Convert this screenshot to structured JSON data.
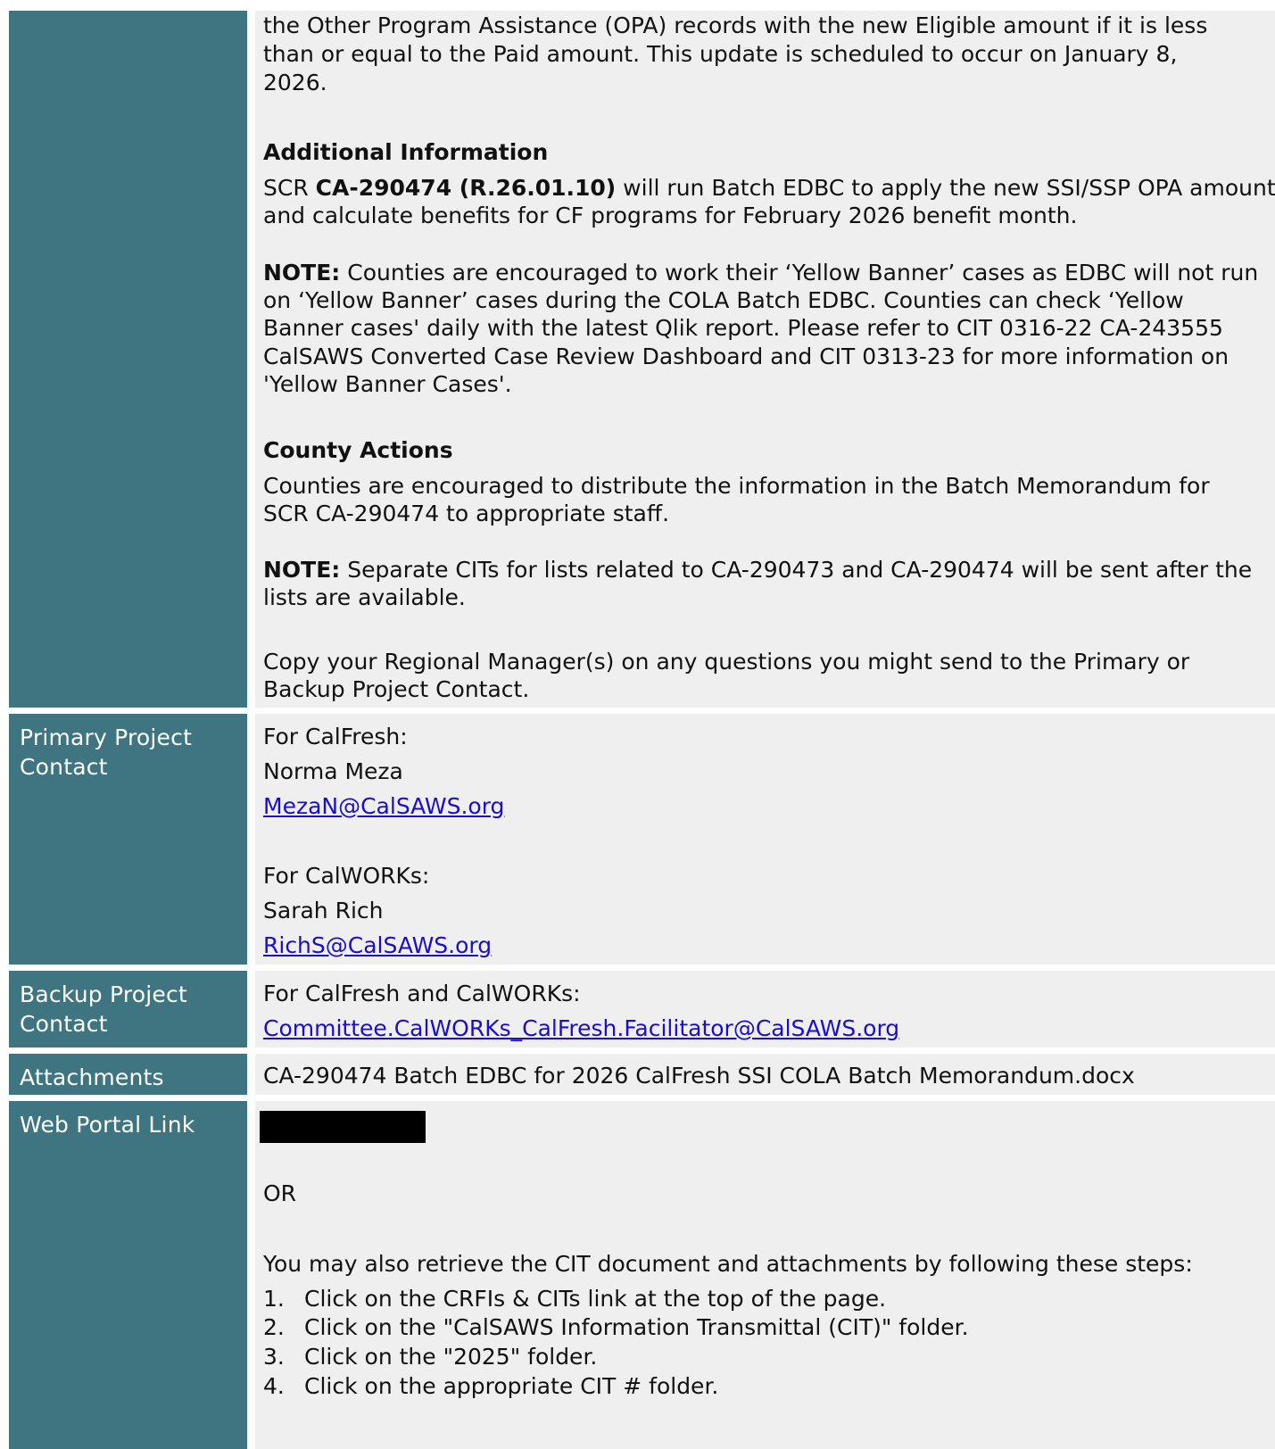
{
  "intro": {
    "lines": [
      "the Other Program Assistance (OPA) records with the new Eligible amount if it is less",
      "than or equal to the Paid amount. This update is scheduled to occur on January 8,",
      "2026."
    ]
  },
  "additional_information": {
    "heading": "Additional Information",
    "scr_prefix": "SCR ",
    "scr_bold": "CA-290474 (R.26.01.10)",
    "scr_line1_rest": " will run Batch EDBC to apply the new SSI/SSP OPA amounts",
    "scr_line2": "and calculate benefits for CF programs for February 2026 benefit month.",
    "note_label": "NOTE:",
    "note_line1_rest": " Counties are encouraged to work their ‘Yellow Banner’ cases as EDBC will not run",
    "note_lines": [
      "on ‘Yellow Banner’ cases during the COLA Batch EDBC.  Counties can check ‘Yellow",
      "Banner cases' daily with the latest Qlik report.  Please refer to CIT 0316-22 CA-243555",
      "CalSAWS Converted Case Review Dashboard and CIT 0313-23 for more information on",
      "'Yellow Banner Cases'."
    ]
  },
  "county_actions": {
    "heading": "County Actions",
    "lines": [
      "Counties are encouraged to distribute the information in the Batch Memorandum for",
      "SCR CA-290474 to appropriate staff."
    ],
    "note_label": "NOTE:",
    "note_line1_rest": " Separate CITs for lists related to CA-290473 and CA-290474 will be sent after the",
    "note_line2": "lists are available.",
    "copy_lines": [
      "Copy your Regional Manager(s) on any questions you might send to the Primary or",
      "Backup Project Contact."
    ]
  },
  "primary_contact": {
    "label_line1": "Primary Project",
    "label_line2": "Contact",
    "calfresh_label": "For CalFresh:",
    "calfresh_name": "Norma Meza",
    "calfresh_email": "MezaN@CalSAWS.org",
    "calworks_label": "For CalWORKs:",
    "calworks_name": "Sarah Rich",
    "calworks_email": "RichS@CalSAWS.org"
  },
  "backup_contact": {
    "label_line1": "Backup Project",
    "label_line2": "Contact",
    "for_label": "For CalFresh and CalWORKs:",
    "email": "Committee.CalWORKs_CalFresh.Facilitator@CalSAWS.org"
  },
  "attachments": {
    "label": "Attachments",
    "value": "CA-290474 Batch EDBC for 2026 CalFresh SSI COLA Batch Memorandum.docx"
  },
  "web_portal": {
    "label": "Web Portal Link",
    "or_text": "OR",
    "retrieve_text": "You may also retrieve the CIT document and attachments by following these steps:",
    "steps": [
      {
        "num": "1.",
        "text": "Click on the CRFIs & CITs link at the top of the page."
      },
      {
        "num": "2.",
        "text": "Click on the \"CalSAWS Information Transmittal (CIT)\" folder."
      },
      {
        "num": "3.",
        "text": "Click on the \"2025\" folder."
      },
      {
        "num": "4.",
        "text": "Click on the appropriate CIT # folder."
      }
    ]
  }
}
